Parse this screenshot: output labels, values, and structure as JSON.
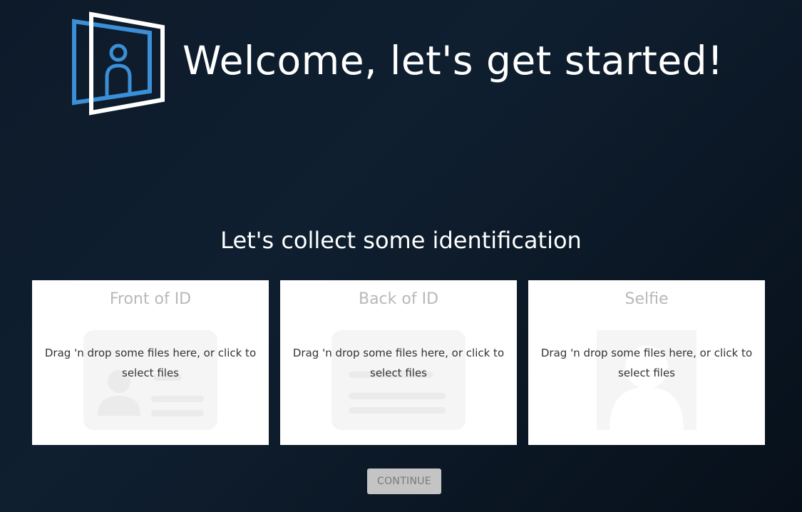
{
  "header": {
    "title": "Welcome, let's get started!",
    "logo_icon": "person-in-frame-logo"
  },
  "subtitle": "Let's collect some identification",
  "upload_cards": [
    {
      "title": "Front of ID",
      "hint": "Drag 'n drop some files here, or click to select files",
      "illustration": "id-card-front-icon"
    },
    {
      "title": "Back of ID",
      "hint": "Drag 'n drop some files here, or click to select files",
      "illustration": "id-card-back-icon"
    },
    {
      "title": "Selfie",
      "hint": "Drag 'n drop some files here, or click to select files",
      "illustration": "selfie-silhouette-icon"
    }
  ],
  "continue_button": {
    "label": "CONTINUE",
    "disabled": true
  },
  "colors": {
    "logo_blue": "#3a8fd6",
    "logo_white": "#ffffff",
    "card_title": "#b8b8b8",
    "illustration": "#f2f2f2",
    "button_bg": "#c4c4c4",
    "button_text": "#7a7a7a"
  }
}
